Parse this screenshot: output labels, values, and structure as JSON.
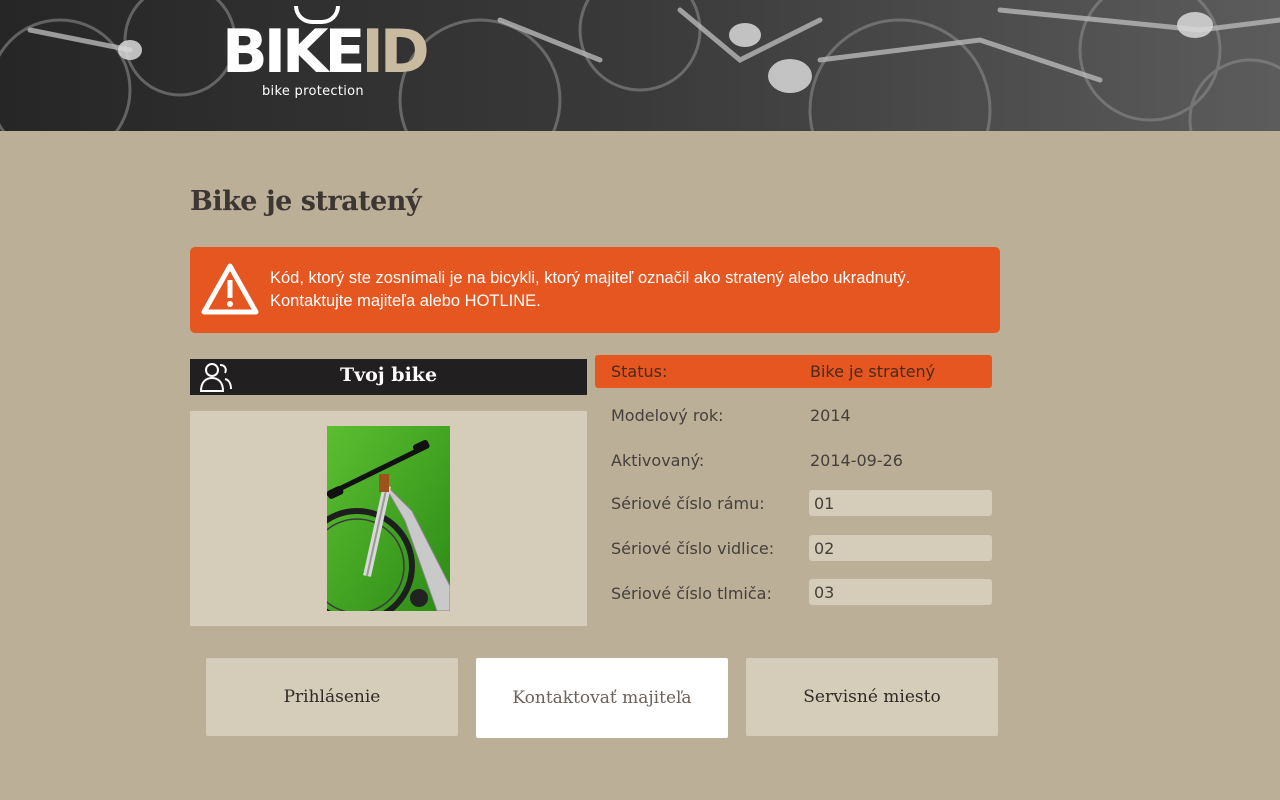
{
  "brand": {
    "logo_main": "BIKE",
    "logo_accent": "ID",
    "tagline": "bike protection"
  },
  "page": {
    "title": "Bike je stratený"
  },
  "alert": {
    "icon": "warning-triangle-icon",
    "line1": "Kód, ktorý ste zosnímali je na bicykli, ktorý majiteľ označil ako stratený alebo ukradnutý.",
    "line2": "Kontaktujte majiteľa alebo HOTLINE.",
    "color": "#e55620"
  },
  "bike_panel": {
    "title": "Tvoj bike",
    "icon": "users-icon"
  },
  "details": {
    "status_label": "Status:",
    "status_value": "Bike je stratený",
    "model_year_label": "Modelový rok:",
    "model_year_value": "2014",
    "activated_label": "Aktivovaný:",
    "activated_value": "2014-09-26",
    "frame_serial_label": "Sériové číslo rámu:",
    "frame_serial_value": "01",
    "fork_serial_label": "Sériové číslo vidlice:",
    "fork_serial_value": "02",
    "shock_serial_label": "Sériové číslo tlmiča:",
    "shock_serial_value": "03"
  },
  "buttons": {
    "login": "Prihlásenie",
    "contact_owner": "Kontaktovať majiteľa",
    "service": "Servisné miesto"
  },
  "colors": {
    "background": "#bcaf98",
    "panel": "#d5ccb9",
    "accent": "#e55620",
    "dark": "#221f20"
  }
}
